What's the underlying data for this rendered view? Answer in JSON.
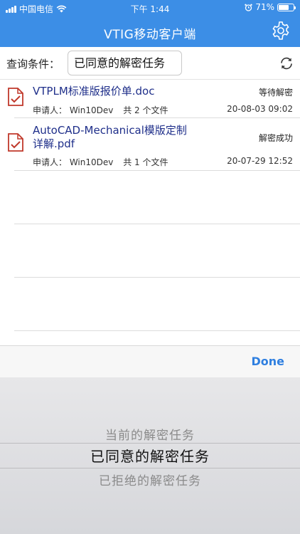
{
  "status_bar": {
    "carrier": "中国电信",
    "time": "下午 1:44",
    "battery": "71%",
    "battery_level": 0.71
  },
  "nav": {
    "title": "VTIG移动客户端",
    "settings_icon": "gear-icon"
  },
  "query": {
    "label": "查询条件：",
    "value": "已同意的解密任务",
    "refresh_icon": "refresh-icon"
  },
  "list": {
    "items": [
      {
        "title_line1": "VTPLM标准版报价单.doc",
        "title_line2": "",
        "status": "等待解密",
        "applicant": "申请人： Win10Dev",
        "files": "共 2 个文件",
        "time": "20-08-03 09:02"
      },
      {
        "title_line1": "AutoCAD-Mechanical模版定制",
        "title_line2": "详解.pdf",
        "status": "解密成功",
        "applicant": "申请人： Win10Dev",
        "files": "共 1 个文件",
        "time": "20-07-29 12:52"
      }
    ]
  },
  "picker": {
    "done_label": "Done",
    "options": [
      "当前的解密任务",
      "已同意的解密任务",
      "已拒绝的解密任务"
    ],
    "selected_index": 1
  },
  "colors": {
    "nav_bar": "#3c8ee6",
    "title_text": "#1f2f8a",
    "icon_red": "#c0392b",
    "done_blue": "#2f7fe0"
  }
}
